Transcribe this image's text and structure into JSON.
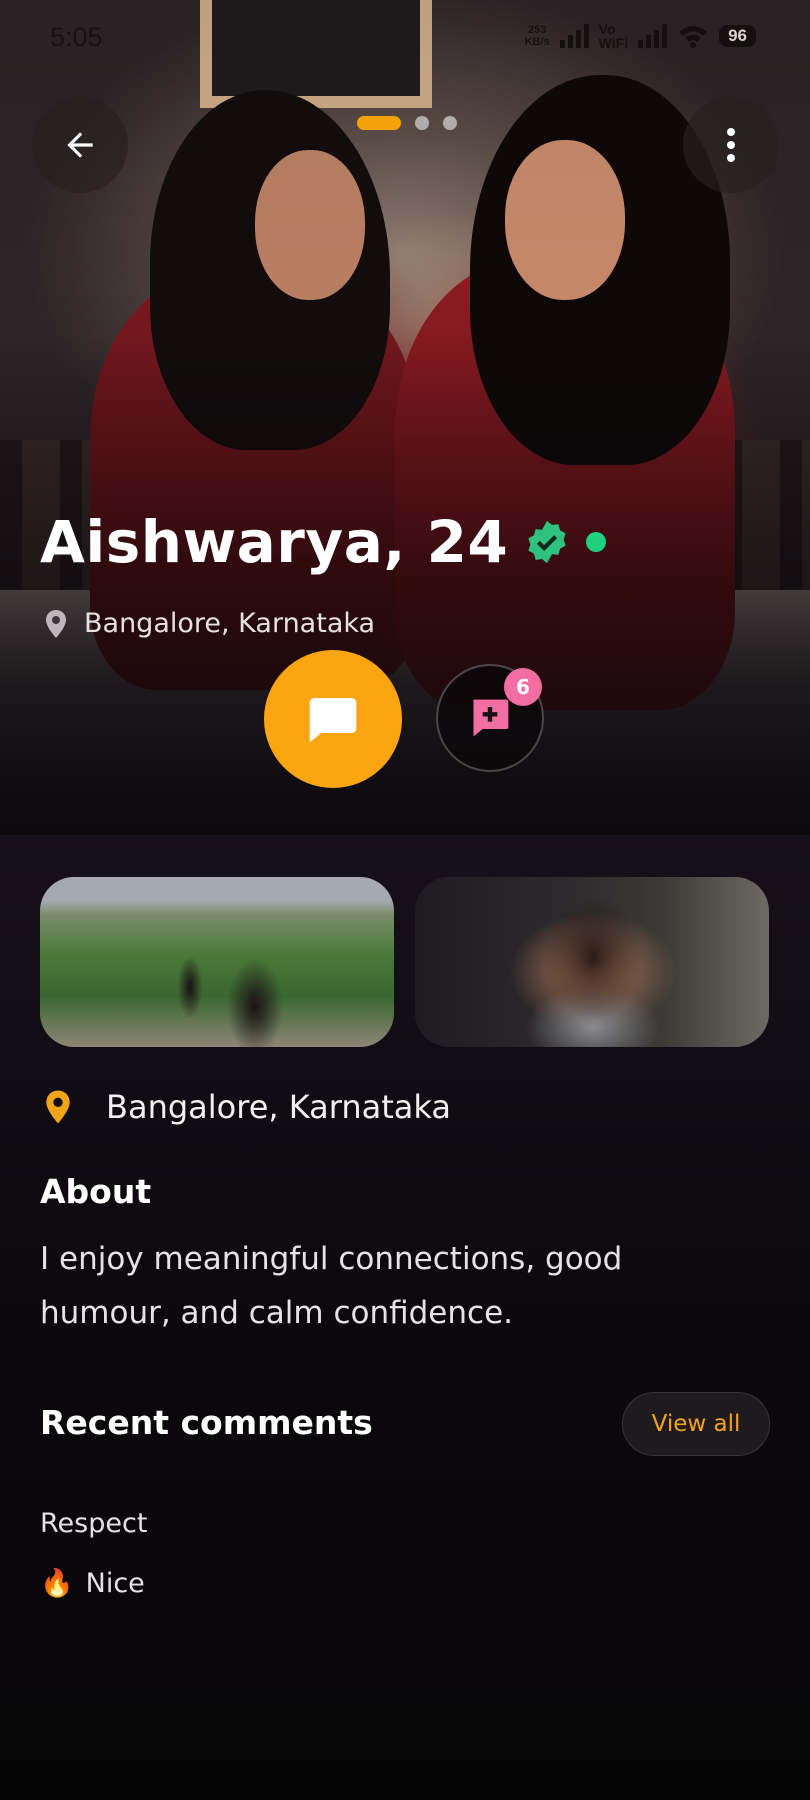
{
  "status_bar": {
    "time": "5:05",
    "speed_value": "253",
    "speed_unit": "KB/s",
    "volte_top": "Vo",
    "volte_bottom": "WiFi",
    "battery": "96"
  },
  "hero": {
    "page_indicator": {
      "total": 3,
      "active": 1
    },
    "name": "Aishwarya, 24",
    "location": "Bangalore, Karnataka",
    "add_badge_count": "6"
  },
  "profile": {
    "location": "Bangalore, Karnataka",
    "about_title": "About",
    "about_text_line1": "I enjoy meaningful connections, good",
    "about_text_line2": "humour, and calm confidence.",
    "recent_comments_title": "Recent comments",
    "view_all_label": "View all",
    "comments": [
      {
        "emoji": "",
        "text": "Respect"
      },
      {
        "emoji": "🔥",
        "text": "Nice"
      }
    ]
  },
  "colors": {
    "accent": "#fba510",
    "online": "#1fd07c",
    "verified": "#2ec27e",
    "badge": "#f26ea2"
  },
  "icons": [
    "back-arrow-icon",
    "more-vert-icon",
    "verified-badge-icon",
    "location-pin-icon",
    "chat-icon",
    "add-comment-icon"
  ]
}
